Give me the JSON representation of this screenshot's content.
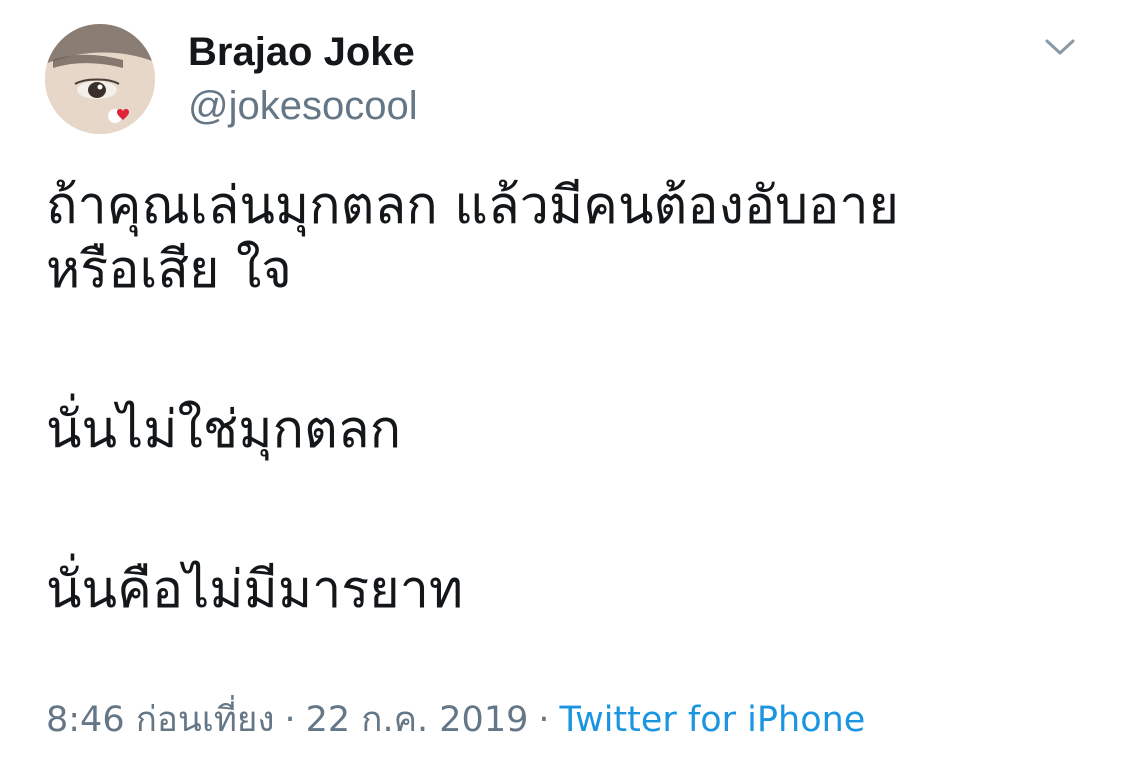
{
  "author": {
    "display_name": "Brajao Joke",
    "handle": "@jokesocool",
    "avatar_icon": "profile-photo"
  },
  "menu": {
    "icon": "chevron-down-icon"
  },
  "tweet": {
    "lines": [
      "ถ้าคุณเล่นมุกตลก แล้วมีคนต้องอับอาย",
      "หรือเสีย ใจ",
      "นั่นไม่ใช่มุกตลก",
      "นั่นคือไม่มีมารยาท"
    ]
  },
  "meta": {
    "time": "8:46 ก่อนเที่ยง",
    "separator": "·",
    "date": "22 ก.ค. 2019",
    "source": "Twitter for iPhone",
    "colors": {
      "muted": "#657786",
      "link": "#1b95e0",
      "text": "#14171a"
    }
  }
}
